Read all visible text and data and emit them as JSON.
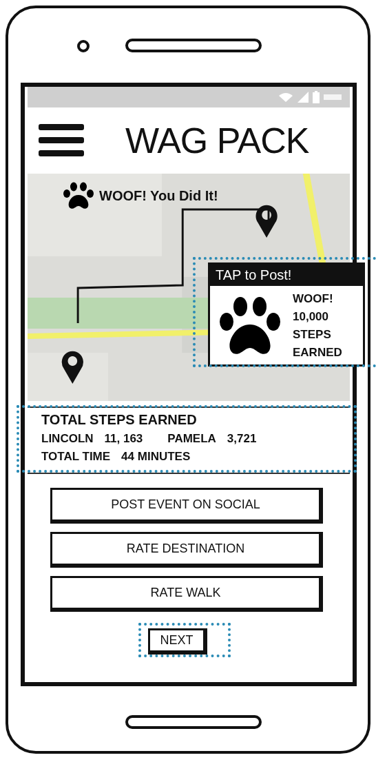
{
  "header": {
    "title": "WAG PACK"
  },
  "map": {
    "banner": "WOOF! You Did It!"
  },
  "post_card": {
    "header": "TAP to Post!",
    "lines": [
      "WOOF!",
      "10,000",
      "STEPS",
      "EARNED"
    ],
    "highlighted": true
  },
  "stats": {
    "title": "TOTAL STEPS EARNED",
    "walkers": [
      {
        "name": "LINCOLN",
        "steps": "11, 163"
      },
      {
        "name": "PAMELA",
        "steps": "3,721"
      }
    ],
    "time_label": "TOTAL TIME",
    "time_value": "44 MINUTES",
    "highlighted": true
  },
  "buttons": [
    {
      "label": "POST EVENT ON SOCIAL"
    },
    {
      "label": "RATE DESTINATION"
    },
    {
      "label": "RATE WALK"
    }
  ],
  "next": {
    "label": "NEXT",
    "highlighted": true
  }
}
